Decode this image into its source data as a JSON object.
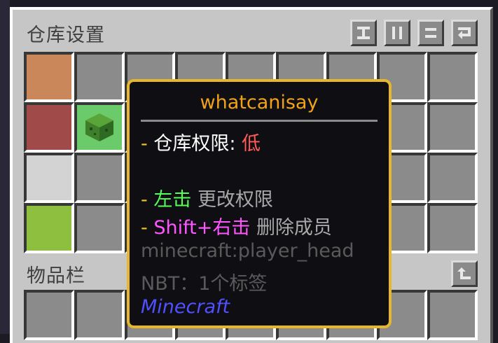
{
  "window": {
    "title": "仓库设置",
    "inventory_title": "物品栏"
  },
  "toolbar": {
    "buttons": [
      {
        "icon": "sort-icon"
      },
      {
        "icon": "pause-icon"
      },
      {
        "icon": "equals-icon"
      },
      {
        "icon": "return-arrow-icon"
      }
    ],
    "inventory_button": {
      "icon": "upload-arrow-icon"
    }
  },
  "slots": {
    "colors": {
      "orange": "#c9875a",
      "red": "#a04a4a",
      "head_bg": "#6bcb6b",
      "light_gray": "#d3d3d3",
      "lime": "#8fbf3f"
    }
  },
  "tooltip": {
    "player_name": "whatcanisay",
    "bullet": "-",
    "permission_label": "仓库权限:",
    "permission_value": "低",
    "left_click": "左击",
    "left_click_action": "更改权限",
    "shift_right_click": "Shift+右击",
    "shift_right_action": "删除成员",
    "item_id": "minecraft:player_head",
    "nbt": "NBT：1个标签",
    "mod_name": "Minecraft"
  }
}
